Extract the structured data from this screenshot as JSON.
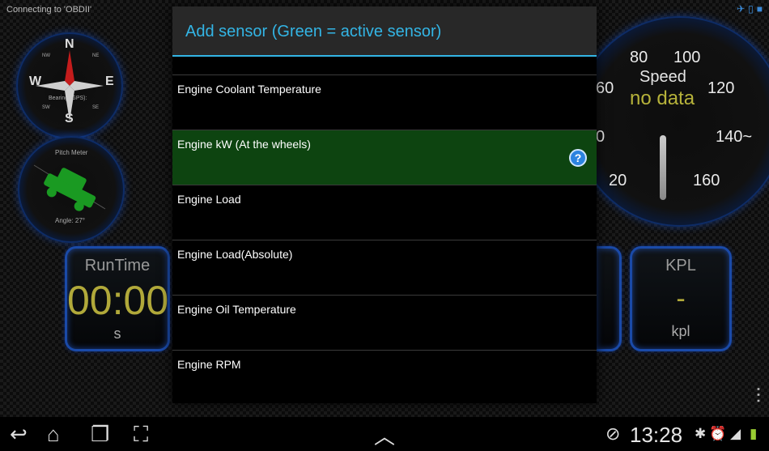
{
  "status": {
    "connecting_text": "Connecting to 'OBDII'"
  },
  "compass": {
    "n": "N",
    "s": "S",
    "e": "E",
    "w": "W",
    "nw": "NW",
    "ne": "NE",
    "sw": "SW",
    "se": "SE",
    "bearing": "Bearing (GPS):"
  },
  "pitch": {
    "title": "Pitch Meter",
    "angle": "Angle: 27°"
  },
  "speed": {
    "label": "Speed",
    "value": "no data",
    "ticks": [
      "80",
      "100",
      "60",
      "120",
      "140~",
      "20",
      "160",
      "0"
    ]
  },
  "runtime": {
    "title": "RunTime",
    "value": "00:00",
    "unit": "s"
  },
  "kpl": {
    "title": "KPL",
    "value": "-",
    "unit": "kpl"
  },
  "dialog": {
    "title": "Add sensor (Green  = active sensor)",
    "items": [
      {
        "label": "Engine Coolant Temperature",
        "active": false
      },
      {
        "label": "Engine kW (At the wheels)",
        "active": true
      },
      {
        "label": "Engine Load",
        "active": false
      },
      {
        "label": "Engine Load(Absolute)",
        "active": false
      },
      {
        "label": "Engine Oil Temperature",
        "active": false
      },
      {
        "label": "Engine RPM",
        "active": false
      }
    ],
    "help_icon": "?"
  },
  "navbar": {
    "time": "13:28"
  },
  "colors": {
    "accent": "#33b5e5",
    "active_row": "#0d4410",
    "gauge_value": "#b1a93a"
  }
}
